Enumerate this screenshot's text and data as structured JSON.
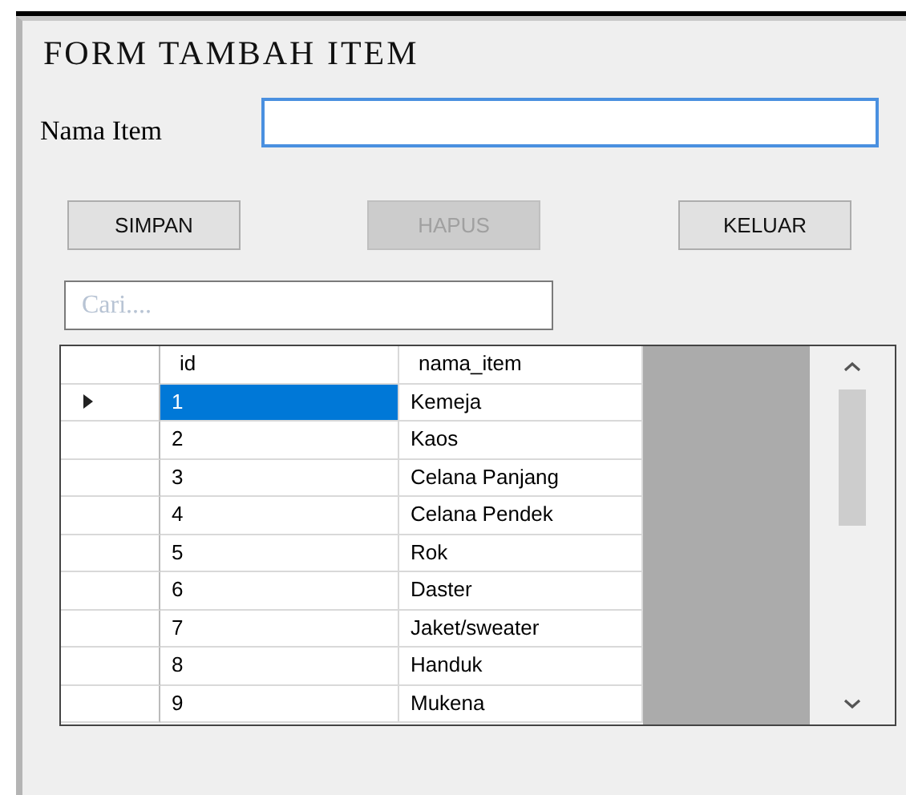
{
  "window": {
    "title": "FORM TAMBAH ITEM"
  },
  "name_field": {
    "label": "Nama Item",
    "focused": true
  },
  "buttons": [
    {
      "label": "SIMPAN",
      "disabled": false
    },
    {
      "label": "HAPUS",
      "disabled": true
    },
    {
      "label": "KELUAR",
      "disabled": false
    }
  ],
  "search": {
    "placeholder": "Cari...."
  },
  "table": {
    "columns": [
      "id",
      "nama_item"
    ],
    "rows": [
      {
        "id": "1",
        "nama_item": "Kemeja",
        "selected": true,
        "current": true
      },
      {
        "id": "2",
        "nama_item": "Kaos",
        "selected": false,
        "current": false
      },
      {
        "id": "3",
        "nama_item": "Celana Panjang",
        "selected": false,
        "current": false
      },
      {
        "id": "4",
        "nama_item": "Celana Pendek",
        "selected": false,
        "current": false
      },
      {
        "id": "5",
        "nama_item": "Rok",
        "selected": false,
        "current": false
      },
      {
        "id": "6",
        "nama_item": "Daster",
        "selected": false,
        "current": false
      },
      {
        "id": "7",
        "nama_item": "Jaket/sweater",
        "selected": false,
        "current": false
      },
      {
        "id": "8",
        "nama_item": "Handuk",
        "selected": false,
        "current": false
      },
      {
        "id": "9",
        "nama_item": "Mukena",
        "selected": false,
        "current": false
      }
    ]
  }
}
